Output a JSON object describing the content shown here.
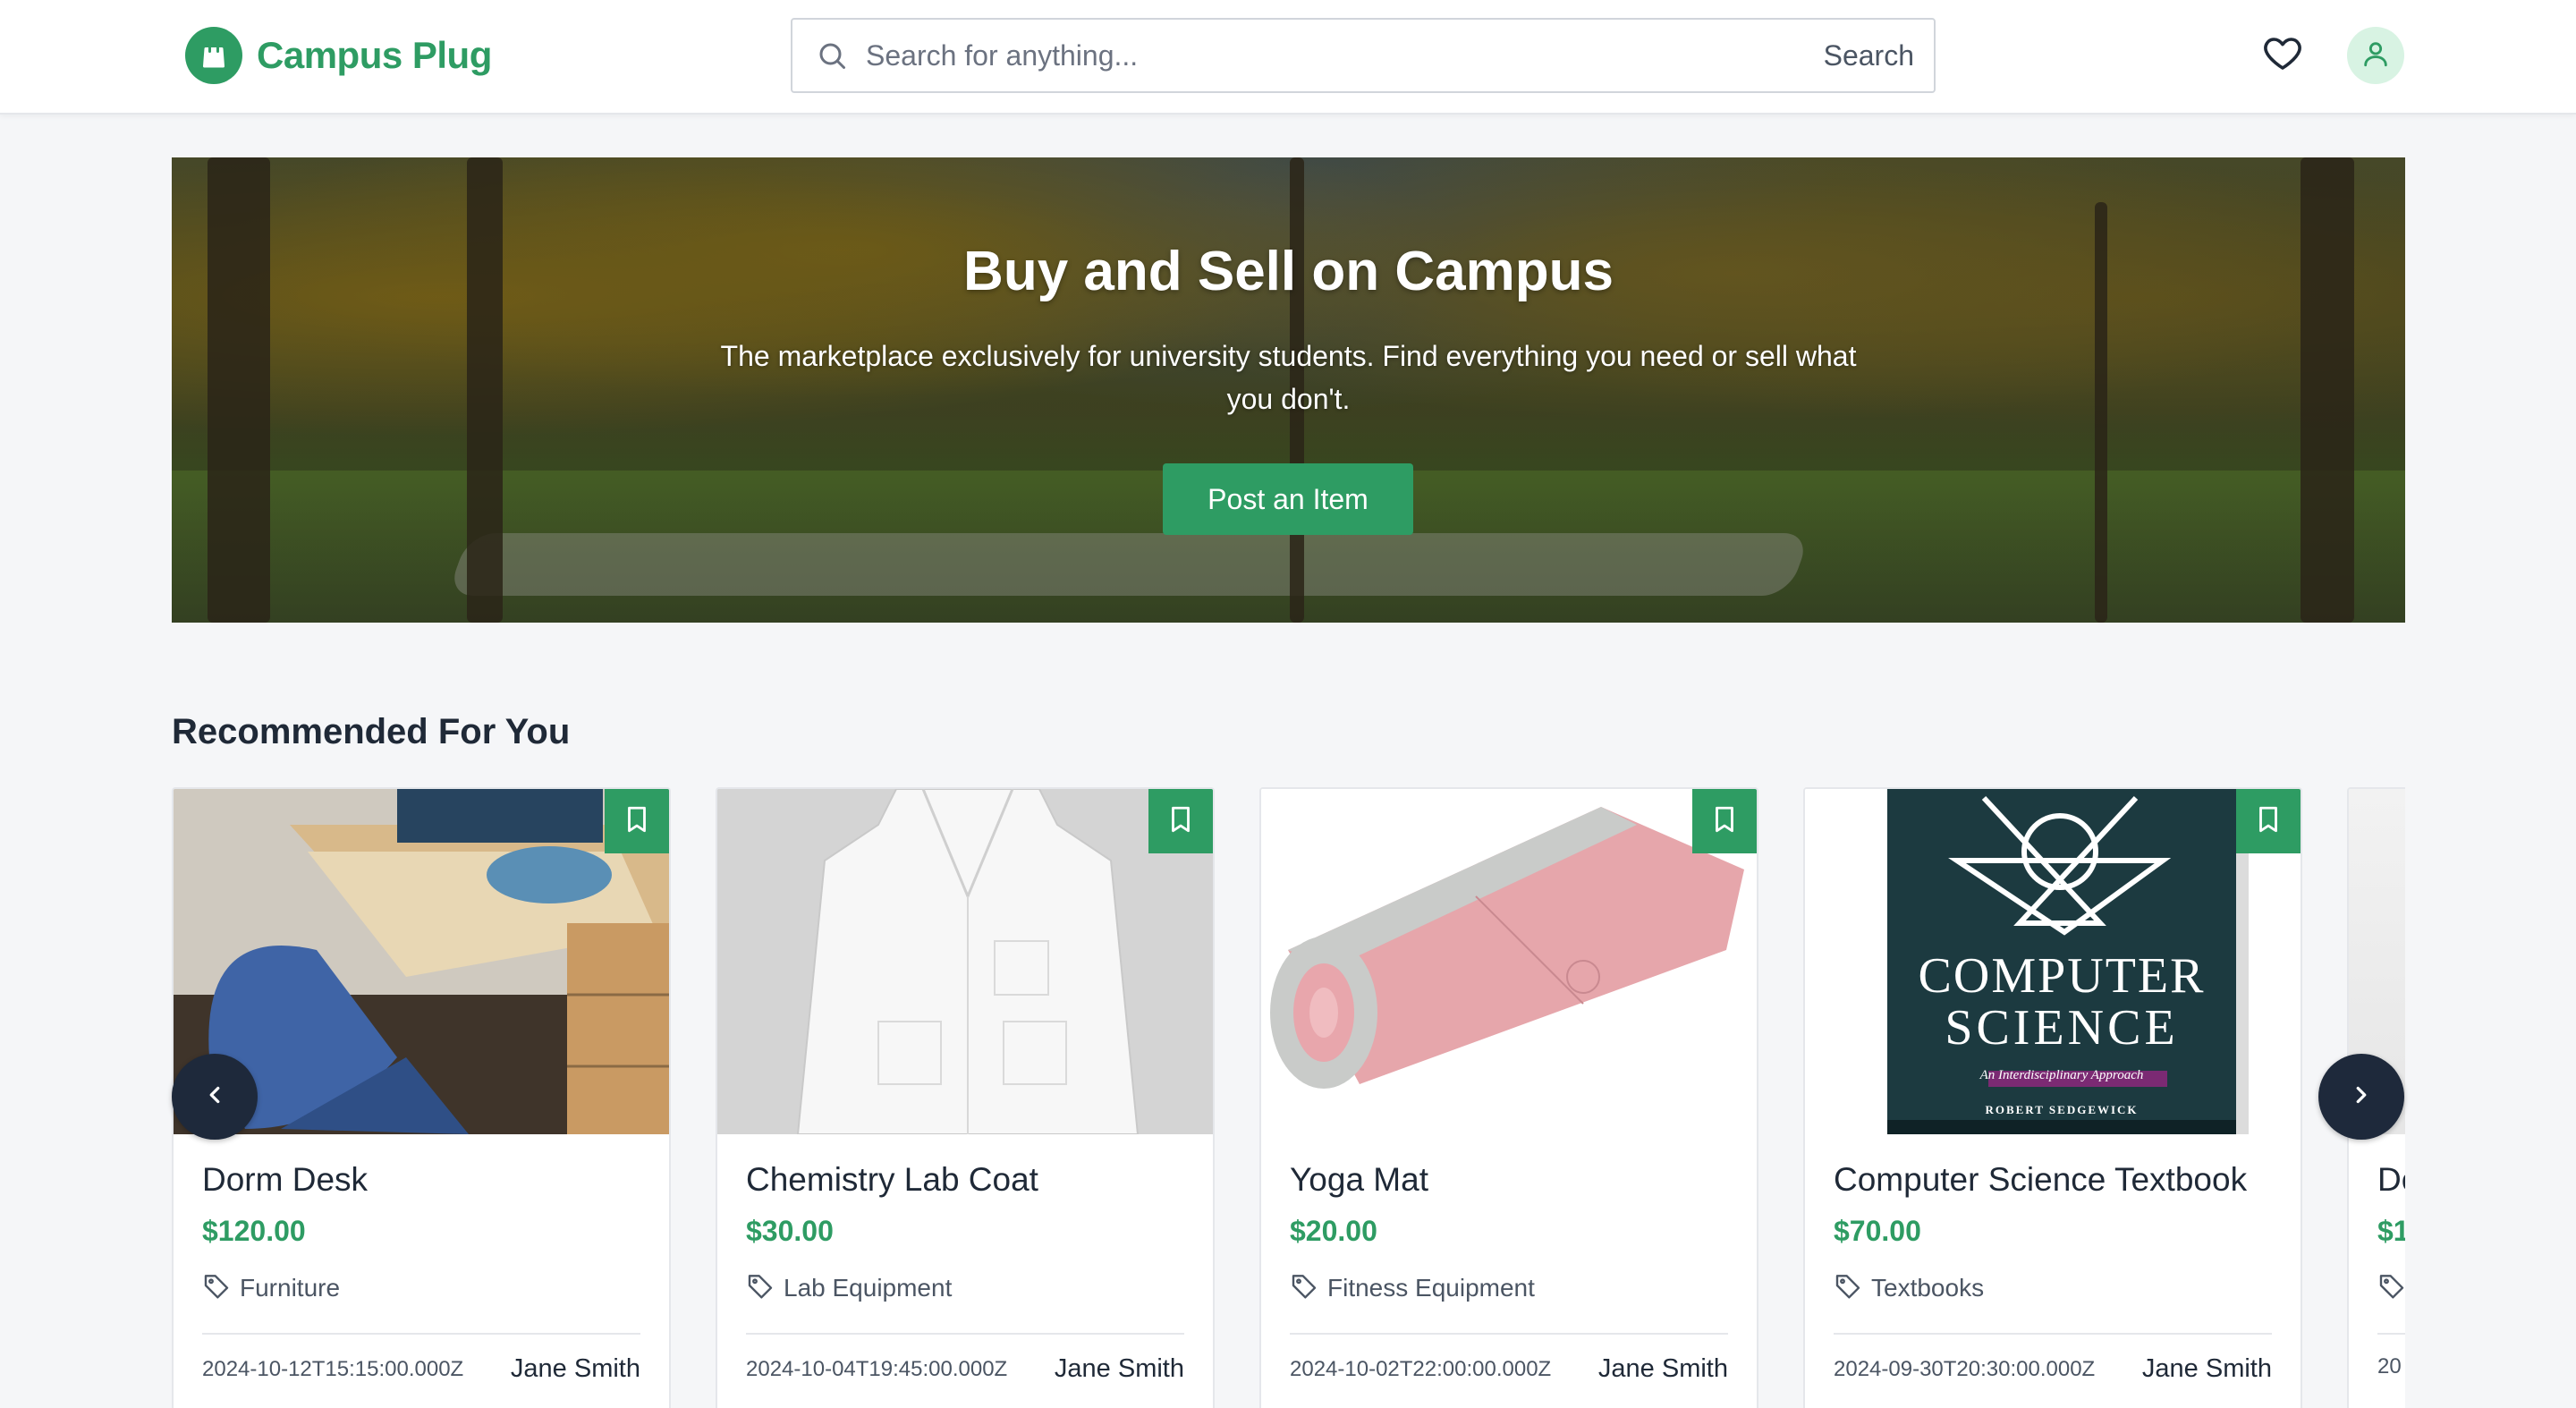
{
  "header": {
    "brand_name": "Campus Plug",
    "search_placeholder": "Search for anything...",
    "search_button": "Search"
  },
  "hero": {
    "title": "Buy and Sell on Campus",
    "subtitle": "The marketplace exclusively for university students. Find everything you need or sell what you don't.",
    "cta_label": "Post an Item"
  },
  "recommended": {
    "title": "Recommended For You",
    "items": [
      {
        "title": "Dorm Desk",
        "price": "$120.00",
        "category": "Furniture",
        "date": "2024-10-12T15:15:00.000Z",
        "seller": "Jane Smith"
      },
      {
        "title": "Chemistry Lab Coat",
        "price": "$30.00",
        "category": "Lab Equipment",
        "date": "2024-10-04T19:45:00.000Z",
        "seller": "Jane Smith"
      },
      {
        "title": "Yoga Mat",
        "price": "$20.00",
        "category": "Fitness Equipment",
        "date": "2024-10-02T22:00:00.000Z",
        "seller": "Jane Smith"
      },
      {
        "title": "Computer Science Textbook",
        "price": "$70.00",
        "category": "Textbooks",
        "date": "2024-09-30T20:30:00.000Z",
        "seller": "Jane Smith"
      },
      {
        "title": "De",
        "price": "$1",
        "category": "",
        "date": "20",
        "seller": ""
      }
    ]
  },
  "book_cover": {
    "line1": "COMPUTER",
    "line2": "SCIENCE",
    "subtitle": "An Interdisciplinary Approach",
    "author": "ROBERT SEDGEWICK"
  },
  "colors": {
    "brand": "#2e9c63",
    "nav_arrow": "#1e293b",
    "avatar_bg": "#d8f3e3"
  },
  "icons": {
    "logo": "shopping-bag-icon",
    "search": "search-icon",
    "favorites": "heart-icon",
    "profile": "user-icon",
    "bookmark": "bookmark-icon",
    "category": "tag-icon",
    "prev": "chevron-left-icon",
    "next": "chevron-right-icon"
  }
}
